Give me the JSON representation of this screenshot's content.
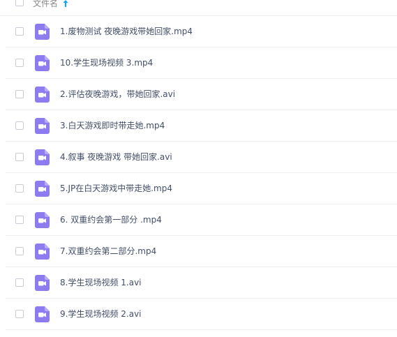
{
  "header": {
    "column_title": "文件名",
    "sort_icon": "sort-ascending-arrow-icon",
    "accent_color": "#06a7ff"
  },
  "file_icon": {
    "name": "video-file-icon",
    "color": "#8c7cf0"
  },
  "files": [
    {
      "name": "1.废物测试 夜晚游戏带她回家.mp4"
    },
    {
      "name": "10.学生现场视频 3.mp4"
    },
    {
      "name": "2.评估夜晚游戏，带她回家.avi"
    },
    {
      "name": "3.白天游戏即时带走她.mp4"
    },
    {
      "name": "4.叙事 夜晚游戏 带她回家.avi"
    },
    {
      "name": "5.JP在白天游戏中带走她.mp4"
    },
    {
      "name": "6. 双重约会第一部分 .mp4"
    },
    {
      "name": "7.双重约会第二部分.mp4"
    },
    {
      "name": "8.学生现场视频 1.avi"
    },
    {
      "name": "9.学生现场视频 2.avi"
    }
  ]
}
